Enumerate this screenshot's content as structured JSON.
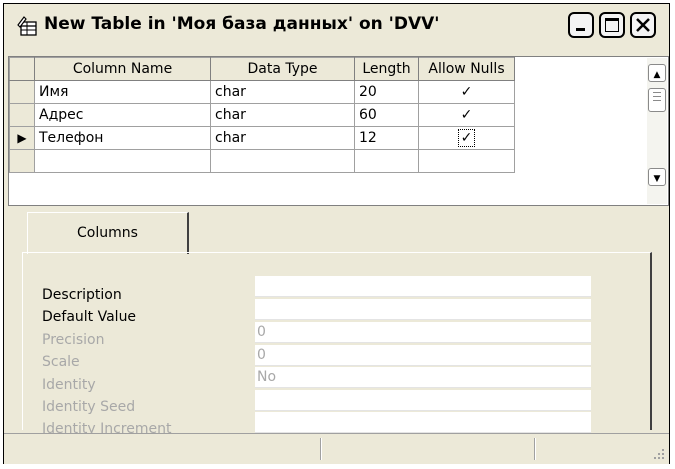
{
  "window": {
    "title": "New Table in 'Моя база данных' on 'DVV'",
    "controls": {
      "minimize": "_",
      "maximize": "□",
      "close": "✕"
    }
  },
  "grid": {
    "columns": [
      "Column Name",
      "Data Type",
      "Length",
      "Allow Nulls"
    ],
    "rows": [
      {
        "name": "Имя",
        "type": "char",
        "length": "20",
        "allow_nulls": "✓",
        "current": false
      },
      {
        "name": "Адрес",
        "type": "char",
        "length": "60",
        "allow_nulls": "✓",
        "current": false
      },
      {
        "name": "Телефон",
        "type": "char",
        "length": "12",
        "allow_nulls": "✓",
        "current": true
      },
      {
        "name": "",
        "type": "",
        "length": "",
        "allow_nulls": "",
        "current": false
      }
    ],
    "current_row_marker": "▶"
  },
  "scrollbar": {
    "up": "▲",
    "down": "▼"
  },
  "properties": {
    "tab_label": "Columns",
    "items": [
      {
        "label": "Description",
        "value": "",
        "enabled": true
      },
      {
        "label": "Default Value",
        "value": "",
        "enabled": true
      },
      {
        "label": "Precision",
        "value": "0",
        "enabled": false
      },
      {
        "label": "Scale",
        "value": "0",
        "enabled": false
      },
      {
        "label": "Identity",
        "value": "No",
        "enabled": false
      },
      {
        "label": "Identity Seed",
        "value": "",
        "enabled": false
      },
      {
        "label": "Identity Increment",
        "value": "",
        "enabled": false
      }
    ]
  },
  "colors": {
    "chrome": "#ece9d8",
    "disabled_text": "#a8a8a8",
    "grid_line": "#a0a0a0"
  }
}
